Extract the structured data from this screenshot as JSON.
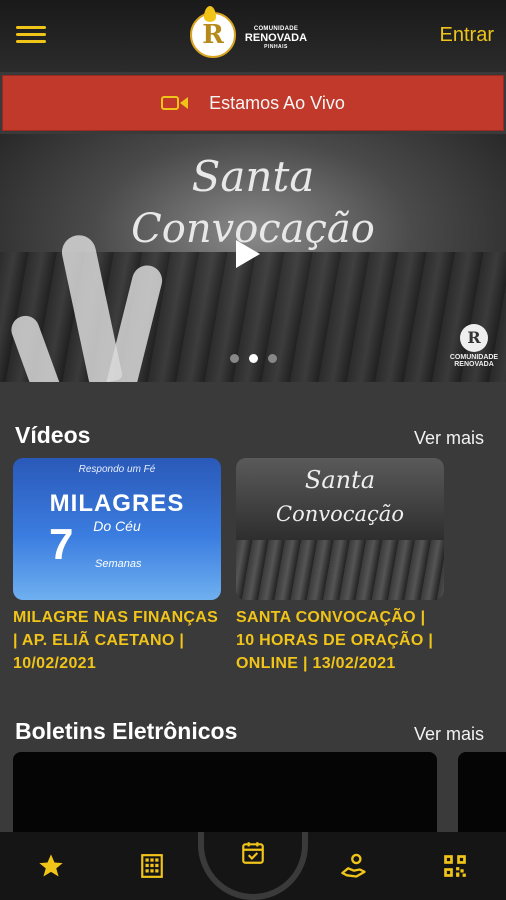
{
  "header": {
    "logo_line1": "COMUNIDADE",
    "logo_line2": "RENOVADA",
    "logo_line3": "PINHAIS",
    "logo_letter": "R",
    "login_label": "Entrar"
  },
  "live": {
    "label": "Estamos Ao Vivo",
    "icon": "video-camera-icon"
  },
  "banner": {
    "title_line1": "Santa",
    "title_line2": "Convocação",
    "logo_text": "COMUNIDADE RENOVADA",
    "dot_count": 3,
    "active_dot": 2
  },
  "videos": {
    "title": "Vídeos",
    "see_more": "Ver mais",
    "items": [
      {
        "title": "MILAGRE NAS FINANÇAS | AP. ELIÃ CAETANO | 10/02/2021",
        "thumb_top": "Respondo um Fé",
        "thumb_main": "MILAGRES",
        "thumb_sub": "Do Céu",
        "thumb_number": "7",
        "thumb_word": "Semanas"
      },
      {
        "title": "SANTA CONVOCAÇÃO | 10 HORAS DE ORAÇÃO | ONLINE | 13/02/2021",
        "thumb_line1": "Santa",
        "thumb_line2": "Convocação"
      }
    ]
  },
  "bulletins": {
    "title": "Boletins Eletrônicos",
    "see_more": "Ver mais"
  },
  "nav": {
    "items": [
      "star-icon",
      "building-icon",
      "calendar-check-icon",
      "hand-giving-icon",
      "qr-code-icon"
    ],
    "accent": "#f0c419"
  }
}
